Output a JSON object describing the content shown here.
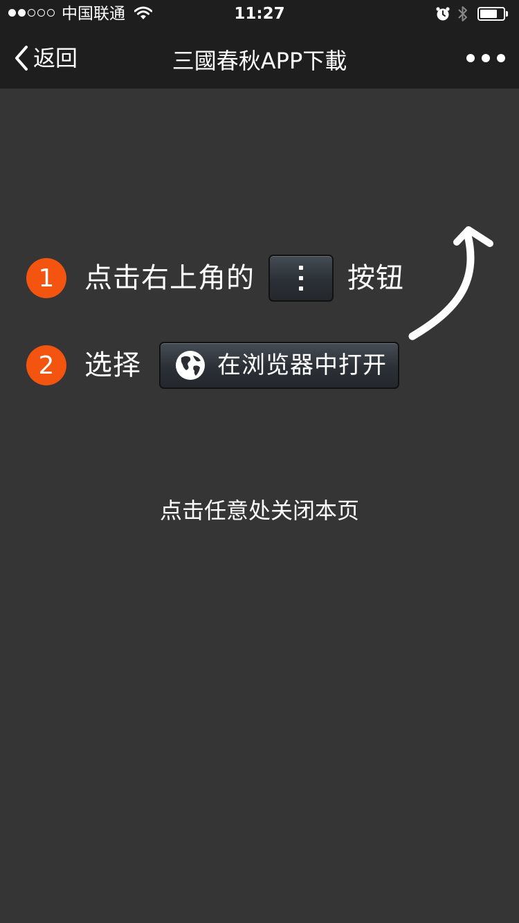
{
  "status_bar": {
    "carrier": "中国联通",
    "time": "11:27",
    "signal_bars_filled": 2,
    "signal_bars_total": 5,
    "battery_level": 0.75
  },
  "nav": {
    "back_label": "返回",
    "title": "三國春秋APP下載",
    "more_icon": "more-dots-icon"
  },
  "steps": [
    {
      "number": "1",
      "text": "点击右上角的",
      "button_icon": "vertical-dots-icon",
      "after_text": "按钮"
    },
    {
      "number": "2",
      "text": "选择",
      "button_icon": "globe-icon",
      "button_label": "在浏览器中打开"
    }
  ],
  "hint": "点击任意处关闭本页",
  "colors": {
    "overlay_bg": "#353535",
    "bar_bg": "#1e1e1e",
    "badge": "#f3540f"
  }
}
